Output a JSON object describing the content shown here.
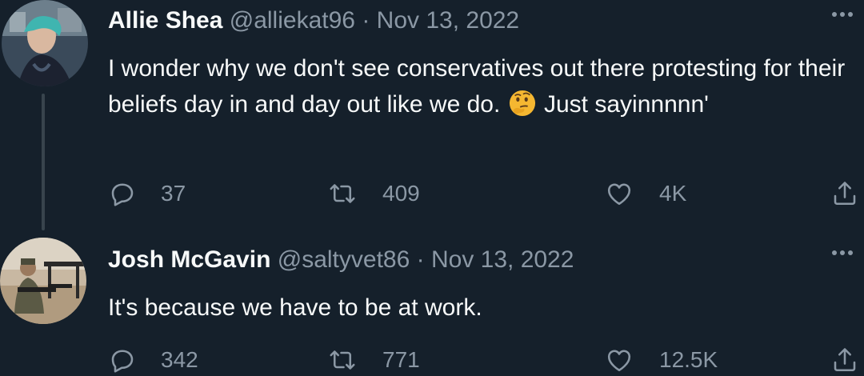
{
  "tweets": [
    {
      "name": "Allie Shea",
      "handle": "@alliekat96",
      "separator": "·",
      "date": "Nov 13, 2022",
      "text_part1": "I wonder why we don't see conservatives out there protesting for their beliefs day in and day out like we do.",
      "emoji": "thinking-face",
      "text_part2": "Just sayinnnnn'",
      "replies": "37",
      "retweets": "409",
      "likes": "4K"
    },
    {
      "name": "Josh McGavin",
      "handle": "@saltyvet86",
      "separator": "·",
      "date": "Nov 13, 2022",
      "text_part1": "It's because we have to be at work.",
      "replies": "342",
      "retweets": "771",
      "likes": "12.5K"
    }
  ],
  "icons": {
    "reply": "reply-icon",
    "retweet": "retweet-icon",
    "like": "heart-icon",
    "share": "share-icon",
    "more": "more-icon"
  },
  "colors": {
    "background": "#15202b",
    "text": "#f7f9f9",
    "secondary": "#8b98a5",
    "thread_line": "#38444d"
  }
}
